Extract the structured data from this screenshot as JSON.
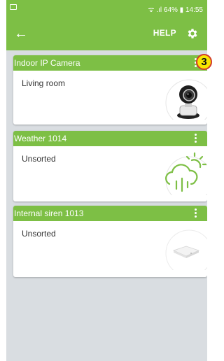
{
  "status_bar": {
    "text": "ᯤ .ıl 64% ▮ 14:55"
  },
  "app_bar": {
    "help_label": "HELP"
  },
  "devices": [
    {
      "name": "Indoor IP Camera",
      "room": "Living room",
      "icon": "camera-icon"
    },
    {
      "name": "Weather 1014",
      "room": "Unsorted",
      "icon": "weather-icon"
    },
    {
      "name": "Internal siren 1013",
      "room": "Unsorted",
      "icon": "siren-icon"
    }
  ],
  "annotation": {
    "badge": "3"
  },
  "colors": {
    "accent": "#7dbf45",
    "background": "#d9dde1",
    "badge": "#f7e600"
  }
}
